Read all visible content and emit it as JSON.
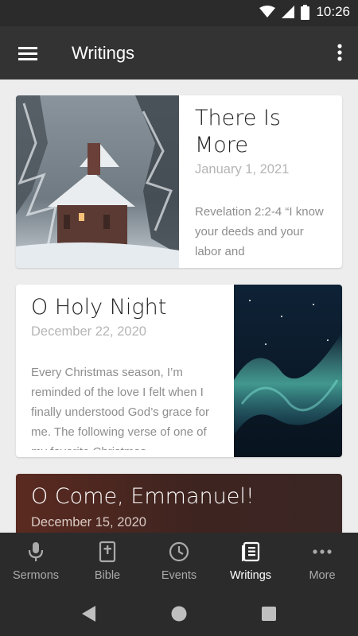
{
  "status_bar": {
    "time": "10:26"
  },
  "app_bar": {
    "title": "Writings",
    "menu_icon": "hamburger-menu-icon",
    "overflow_icon": "more-vert-icon"
  },
  "cards": [
    {
      "title": "There Is More",
      "date": "January 1, 2021",
      "excerpt": "Revelation 2:2-4  “I know your deeds and your labor and",
      "image": "snowy-chapel-image"
    },
    {
      "title": "O Holy Night",
      "date": "December 22, 2020",
      "excerpt": "Every Christmas season, I’m reminded of the love I felt when I finally understood God’s grace for me. The following verse of one of my favorite Christmas",
      "image": "aurora-night-sky-image"
    },
    {
      "title": "O Come, Emmanuel!",
      "date": "December 15, 2020"
    }
  ],
  "bottom_nav": {
    "items": [
      {
        "label": "Sermons",
        "icon": "microphone-icon",
        "active": false
      },
      {
        "label": "Bible",
        "icon": "bible-icon",
        "active": false
      },
      {
        "label": "Events",
        "icon": "clock-icon",
        "active": false
      },
      {
        "label": "Writings",
        "icon": "writings-book-icon",
        "active": true
      },
      {
        "label": "More",
        "icon": "more-horiz-icon",
        "active": false
      }
    ]
  },
  "colors": {
    "app_bar": "#333333",
    "status_bar": "#2b2b2b",
    "background": "#ededed",
    "nav_active": "#ffffff",
    "nav_inactive": "#aaaaaa"
  }
}
